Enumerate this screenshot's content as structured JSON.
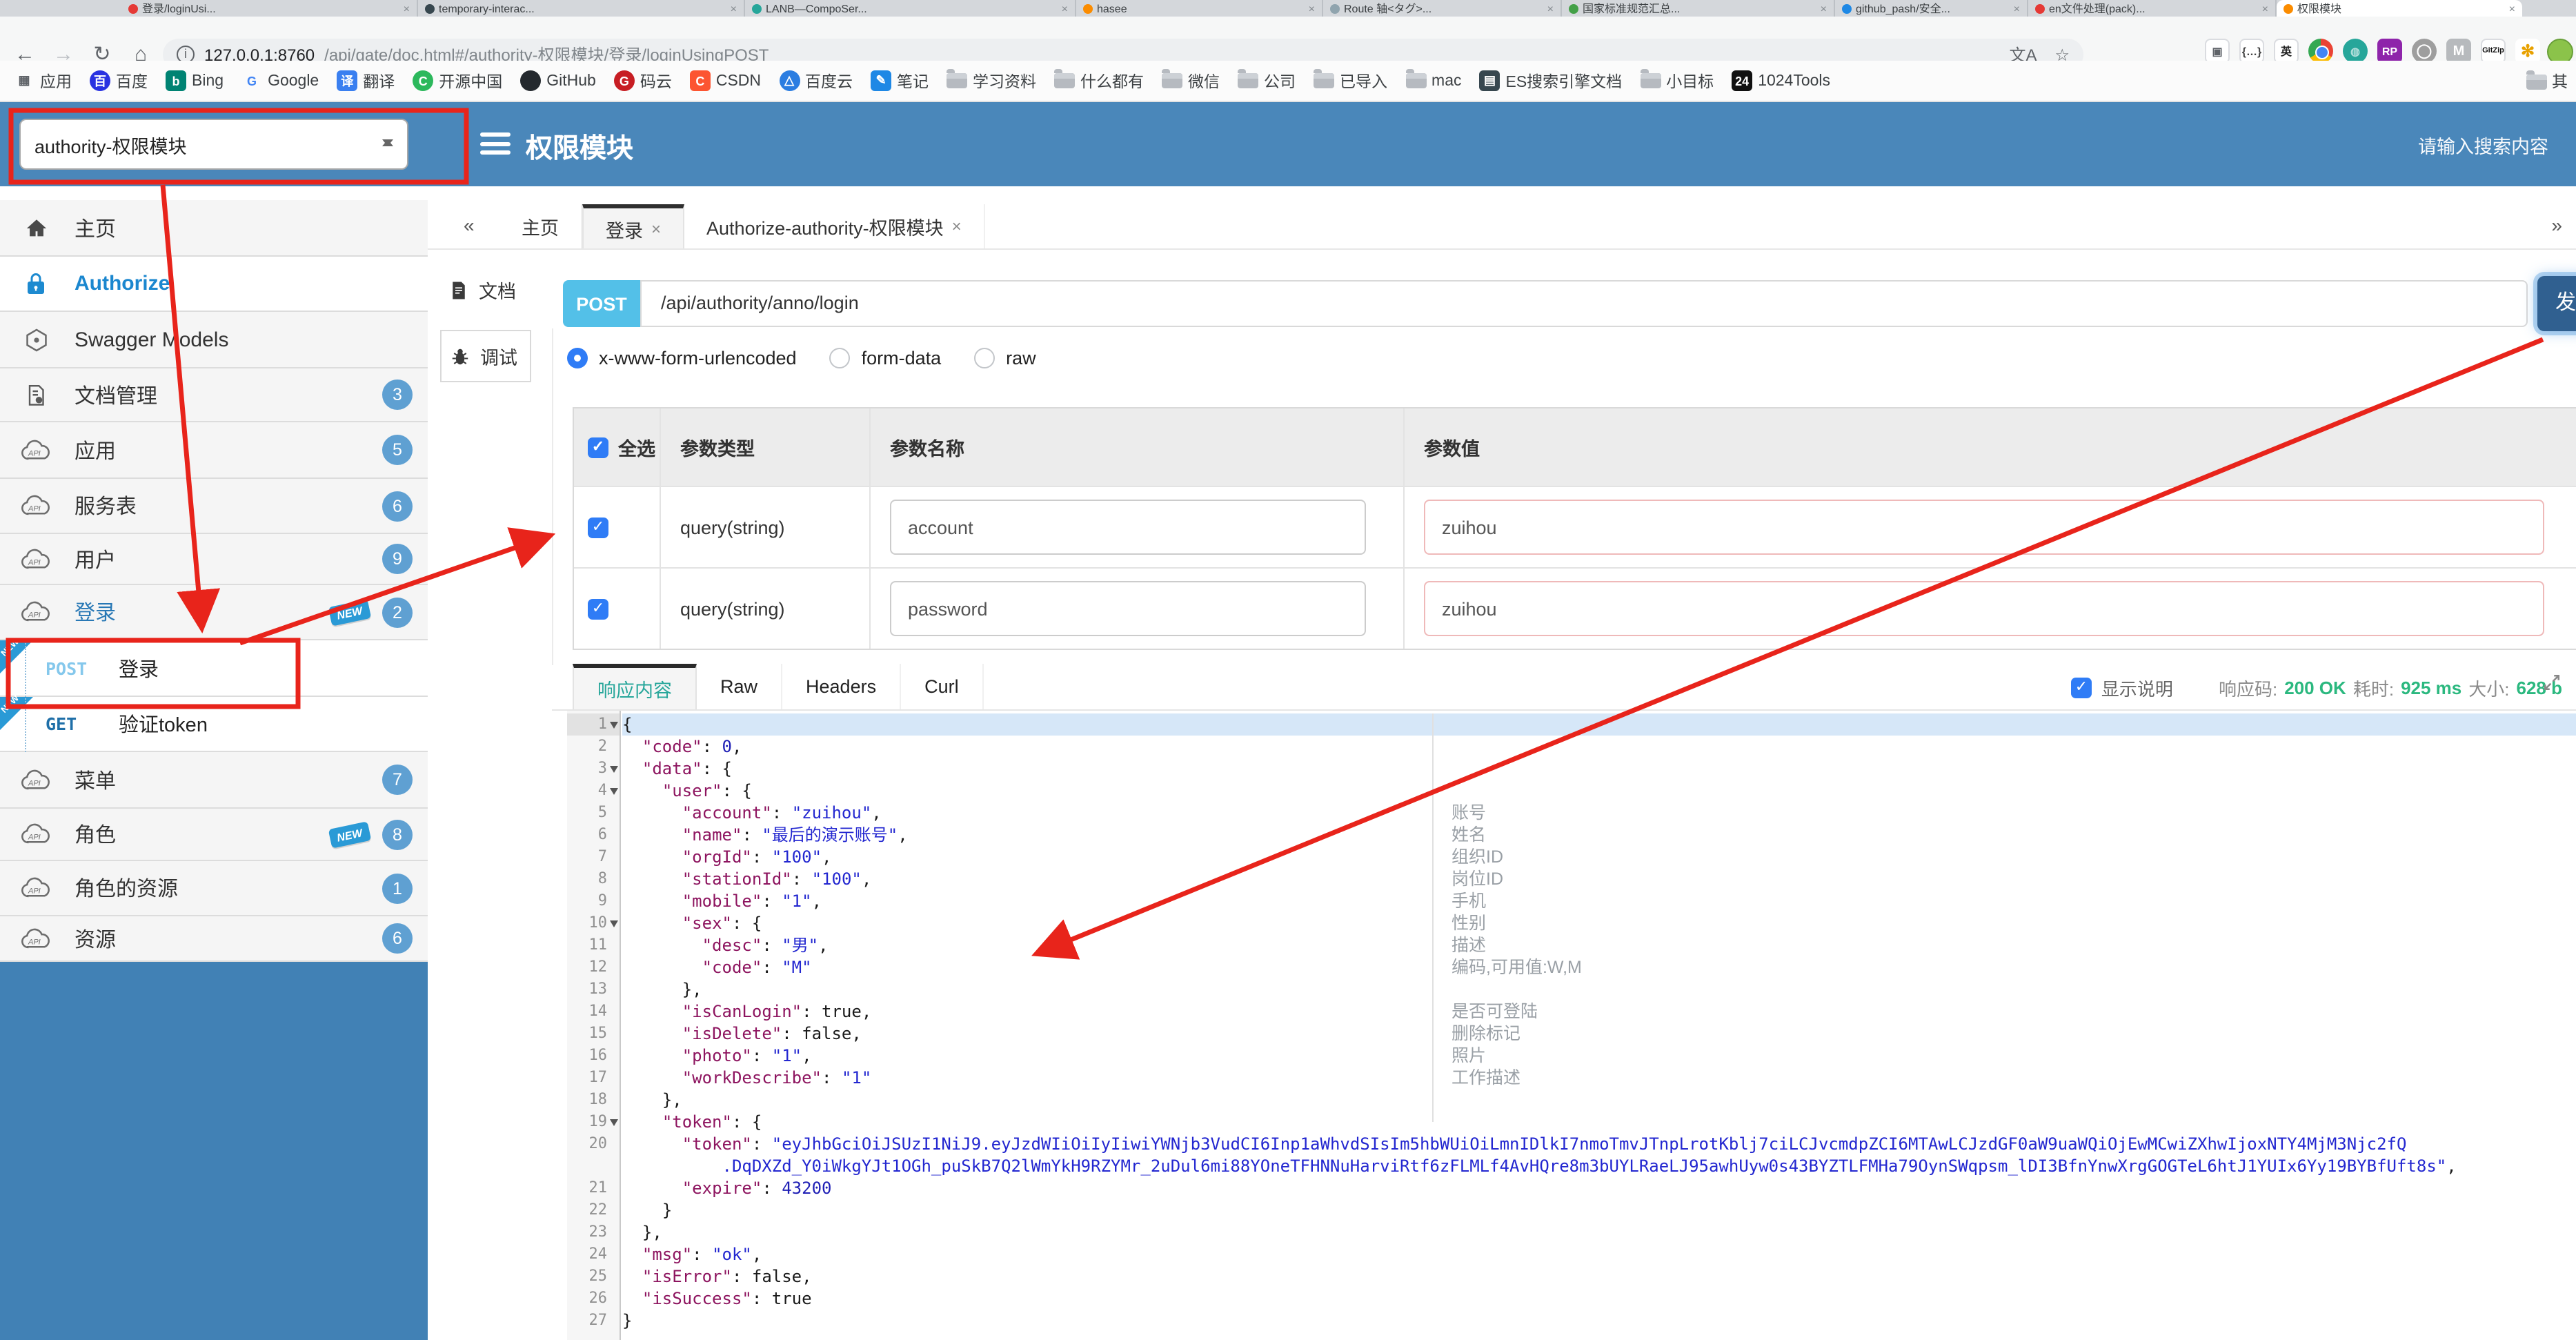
{
  "browser": {
    "tabs": [
      {
        "label": "登录/loginUsi...",
        "color": "#e53935"
      },
      {
        "label": "temporary-interac...",
        "color": "#37474f"
      },
      {
        "label": "LANB—CompoSer...",
        "color": "#26a69a"
      },
      {
        "label": "hasee",
        "color": "#fb8c00"
      },
      {
        "label": "Route 轴<タグ>...",
        "color": "#90a4ae"
      },
      {
        "label": "国家标准规范汇总...",
        "color": "#43a047"
      },
      {
        "label": "github_pash/安全...",
        "color": "#1e88e5"
      },
      {
        "label": "en文件处理(pack)...",
        "color": "#e53935"
      },
      {
        "label": "权限模块",
        "color": "#fb8c00",
        "active": true
      }
    ],
    "url_host": "127.0.0.1:8760",
    "url_path": "/api/gate/doc.html#/authority-权限模块/登录/loginUsingPOST",
    "bookmarks": [
      {
        "label": "应用",
        "icon": "apps"
      },
      {
        "label": "百度",
        "icon": "baidu"
      },
      {
        "label": "Bing",
        "icon": "bing"
      },
      {
        "label": "Google",
        "icon": "google"
      },
      {
        "label": "翻译",
        "icon": "translate"
      },
      {
        "label": "开源中国",
        "icon": "osc"
      },
      {
        "label": "GitHub",
        "icon": "github"
      },
      {
        "label": "码云",
        "icon": "gitee"
      },
      {
        "label": "CSDN",
        "icon": "csdn"
      },
      {
        "label": "百度云",
        "icon": "baiduyun"
      },
      {
        "label": "笔记",
        "icon": "note"
      },
      {
        "label": "学习资料",
        "icon": "folder"
      },
      {
        "label": "什么都有",
        "icon": "folder"
      },
      {
        "label": "微信",
        "icon": "folder"
      },
      {
        "label": "公司",
        "icon": "folder"
      },
      {
        "label": "已导入",
        "icon": "folder"
      },
      {
        "label": "mac",
        "icon": "folder"
      },
      {
        "label": "ES搜索引擎文档",
        "icon": "book"
      },
      {
        "label": "小目标",
        "icon": "folder"
      },
      {
        "label": "1024Tools",
        "icon": "tools1024"
      }
    ],
    "bookmark_overflow": {
      "label": "其",
      "icon": "folder"
    },
    "extensions": [
      "postman",
      "braces",
      "en-translate",
      "chrome",
      "globe",
      "rp",
      "ring",
      "m-chevron",
      "gitzip",
      "pinwheel"
    ]
  },
  "header": {
    "module_select": "authority-权限模块",
    "title": "权限模块",
    "search_placeholder": "请输入搜索内容"
  },
  "sidebar": {
    "items": [
      {
        "label": "主页",
        "icon": "home"
      },
      {
        "label": "Authorize",
        "icon": "lock",
        "active": true
      },
      {
        "label": "Swagger Models",
        "icon": "swagger"
      },
      {
        "label": "文档管理",
        "icon": "docs",
        "badge": "3"
      },
      {
        "label": "应用",
        "icon": "cloud",
        "badge": "5"
      },
      {
        "label": "服务表",
        "icon": "cloud",
        "badge": "6"
      },
      {
        "label": "用户",
        "icon": "cloud",
        "badge": "9"
      },
      {
        "label": "登录",
        "icon": "cloud",
        "badge": "2",
        "new": true,
        "open": true
      },
      {
        "child": true,
        "method": "POST",
        "label": "登录",
        "new": true,
        "boxed": true
      },
      {
        "child": true,
        "method": "GET",
        "label": "验证token",
        "new": true
      },
      {
        "label": "菜单",
        "icon": "cloud",
        "badge": "7"
      },
      {
        "label": "角色",
        "icon": "cloud",
        "badge": "8",
        "new": true
      },
      {
        "label": "角色的资源",
        "icon": "cloud",
        "badge": "1"
      },
      {
        "label": "资源",
        "icon": "cloud",
        "badge": "6"
      }
    ]
  },
  "tabbar": {
    "collapse": "«",
    "expand": "»",
    "tabs": [
      {
        "label": "主页",
        "closable": false
      },
      {
        "label": "登录",
        "closable": true,
        "active": true
      },
      {
        "label": "Authorize-authority-权限模块",
        "closable": true
      }
    ]
  },
  "doc_nav": {
    "doc": "文档",
    "debug": "调试"
  },
  "request": {
    "method": "POST",
    "url": "/api/authority/anno/login",
    "send_label": "发",
    "content_types": [
      "x-www-form-urlencoded",
      "form-data",
      "raw"
    ],
    "selected_type": 0
  },
  "params": {
    "headers": [
      "全选",
      "参数类型",
      "参数名称",
      "参数值"
    ],
    "rows": [
      {
        "checked": true,
        "type": "query(string)",
        "name": "account",
        "value": "zuihou"
      },
      {
        "checked": true,
        "type": "query(string)",
        "name": "password",
        "value": "zuihou"
      }
    ]
  },
  "response": {
    "tabs": [
      "响应内容",
      "Raw",
      "Headers",
      "Curl"
    ],
    "active_tab": 0,
    "show_desc_label": "显示说明",
    "code_label": "响应码:",
    "code_value": "200 OK",
    "time_label": "耗时:",
    "time_value": "925 ms",
    "size_label": "大小:",
    "size_value": "628 b"
  },
  "editor": {
    "rows": [
      {
        "n": "1",
        "f": true,
        "a": true,
        "t": [
          [
            "p",
            "{"
          ]
        ]
      },
      {
        "n": "2",
        "t": [
          [
            "w",
            "  "
          ],
          [
            "k",
            "\"code\""
          ],
          [
            "p",
            ": "
          ],
          [
            "n",
            "0"
          ],
          [
            "p",
            ","
          ]
        ]
      },
      {
        "n": "3",
        "f": true,
        "t": [
          [
            "w",
            "  "
          ],
          [
            "k",
            "\"data\""
          ],
          [
            "p",
            ": {"
          ]
        ]
      },
      {
        "n": "4",
        "f": true,
        "t": [
          [
            "w",
            "    "
          ],
          [
            "k",
            "\"user\""
          ],
          [
            "p",
            ": {"
          ]
        ]
      },
      {
        "n": "5",
        "t": [
          [
            "w",
            "      "
          ],
          [
            "k",
            "\"account\""
          ],
          [
            "p",
            ": "
          ],
          [
            "s",
            "\"zuihou\""
          ],
          [
            "p",
            ","
          ]
        ]
      },
      {
        "n": "6",
        "t": [
          [
            "w",
            "      "
          ],
          [
            "k",
            "\"name\""
          ],
          [
            "p",
            ": "
          ],
          [
            "s",
            "\"最后的演示账号\""
          ],
          [
            "p",
            ","
          ]
        ]
      },
      {
        "n": "7",
        "t": [
          [
            "w",
            "      "
          ],
          [
            "k",
            "\"orgId\""
          ],
          [
            "p",
            ": "
          ],
          [
            "s",
            "\"100\""
          ],
          [
            "p",
            ","
          ]
        ]
      },
      {
        "n": "8",
        "t": [
          [
            "w",
            "      "
          ],
          [
            "k",
            "\"stationId\""
          ],
          [
            "p",
            ": "
          ],
          [
            "s",
            "\"100\""
          ],
          [
            "p",
            ","
          ]
        ]
      },
      {
        "n": "9",
        "t": [
          [
            "w",
            "      "
          ],
          [
            "k",
            "\"mobile\""
          ],
          [
            "p",
            ": "
          ],
          [
            "s",
            "\"1\""
          ],
          [
            "p",
            ","
          ]
        ]
      },
      {
        "n": "10",
        "f": true,
        "t": [
          [
            "w",
            "      "
          ],
          [
            "k",
            "\"sex\""
          ],
          [
            "p",
            ": {"
          ]
        ]
      },
      {
        "n": "11",
        "t": [
          [
            "w",
            "        "
          ],
          [
            "k",
            "\"desc\""
          ],
          [
            "p",
            ": "
          ],
          [
            "s",
            "\"男\""
          ],
          [
            "p",
            ","
          ]
        ]
      },
      {
        "n": "12",
        "t": [
          [
            "w",
            "        "
          ],
          [
            "k",
            "\"code\""
          ],
          [
            "p",
            ": "
          ],
          [
            "s",
            "\"M\""
          ]
        ]
      },
      {
        "n": "13",
        "t": [
          [
            "w",
            "      "
          ],
          [
            "p",
            "},"
          ]
        ]
      },
      {
        "n": "14",
        "t": [
          [
            "w",
            "      "
          ],
          [
            "k",
            "\"isCanLogin\""
          ],
          [
            "p",
            ": "
          ],
          [
            "b",
            "true"
          ],
          [
            "p",
            ","
          ]
        ]
      },
      {
        "n": "15",
        "t": [
          [
            "w",
            "      "
          ],
          [
            "k",
            "\"isDelete\""
          ],
          [
            "p",
            ": "
          ],
          [
            "b",
            "false"
          ],
          [
            "p",
            ","
          ]
        ]
      },
      {
        "n": "16",
        "t": [
          [
            "w",
            "      "
          ],
          [
            "k",
            "\"photo\""
          ],
          [
            "p",
            ": "
          ],
          [
            "s",
            "\"1\""
          ],
          [
            "p",
            ","
          ]
        ]
      },
      {
        "n": "17",
        "t": [
          [
            "w",
            "      "
          ],
          [
            "k",
            "\"workDescribe\""
          ],
          [
            "p",
            ": "
          ],
          [
            "s",
            "\"1\""
          ]
        ]
      },
      {
        "n": "18",
        "t": [
          [
            "w",
            "    "
          ],
          [
            "p",
            "},"
          ]
        ]
      },
      {
        "n": "19",
        "f": true,
        "t": [
          [
            "w",
            "    "
          ],
          [
            "k",
            "\"token\""
          ],
          [
            "p",
            ": {"
          ]
        ]
      },
      {
        "n": "20",
        "t": [
          [
            "w",
            "      "
          ],
          [
            "k",
            "\"token\""
          ],
          [
            "p",
            ": "
          ],
          [
            "s",
            "\"eyJhbGciOiJSUzI1NiJ9.eyJzdWIiOiIyIiwiYWNjb3VudCI6Inp1aWhvdSIsIm5hbWUiOiLmnIDlkI7nmoTmvJTnpLrotKblj7ciLCJvcmdpZCI6MTAwLCJzdGF0aW9uaWQiOjEwMCwiZXhwIjoxNTY4MjM3Njc2fQ"
          ]
        ]
      },
      {
        "n": "",
        "t": [
          [
            "w",
            "          "
          ],
          [
            "s",
            ".DqDXZd_Y0iWkgYJt1OGh_puSkB7Q2lWmYkH9RZYMr_2uDul6mi88YOneTFHNNuHarviRtf6zFLMLf4AvHQre8m3bUYLRaeLJ95awhUyw0s43BYZTLFMHa79OynSWqpsm_lDI3BfnYnwXrgGOGTeL6htJ1YUIx6Yy19BYBfUft8s\""
          ],
          [
            "p",
            ","
          ]
        ]
      },
      {
        "n": "21",
        "t": [
          [
            "w",
            "      "
          ],
          [
            "k",
            "\"expire\""
          ],
          [
            "p",
            ": "
          ],
          [
            "n",
            "43200"
          ]
        ]
      },
      {
        "n": "22",
        "t": [
          [
            "w",
            "    "
          ],
          [
            "p",
            "}"
          ]
        ]
      },
      {
        "n": "23",
        "t": [
          [
            "w",
            "  "
          ],
          [
            "p",
            "},"
          ]
        ]
      },
      {
        "n": "24",
        "t": [
          [
            "w",
            "  "
          ],
          [
            "k",
            "\"msg\""
          ],
          [
            "p",
            ": "
          ],
          [
            "s",
            "\"ok\""
          ],
          [
            "p",
            ","
          ]
        ]
      },
      {
        "n": "25",
        "t": [
          [
            "w",
            "  "
          ],
          [
            "k",
            "\"isError\""
          ],
          [
            "p",
            ": "
          ],
          [
            "b",
            "false"
          ],
          [
            "p",
            ","
          ]
        ]
      },
      {
        "n": "26",
        "t": [
          [
            "w",
            "  "
          ],
          [
            "k",
            "\"isSuccess\""
          ],
          [
            "p",
            ": "
          ],
          [
            "b",
            "true"
          ]
        ]
      },
      {
        "n": "27",
        "t": [
          [
            "p",
            "}"
          ]
        ]
      }
    ],
    "annotations": [
      {
        "row": 5,
        "text": "账号"
      },
      {
        "row": 6,
        "text": "姓名"
      },
      {
        "row": 7,
        "text": "组织ID"
      },
      {
        "row": 8,
        "text": "岗位ID"
      },
      {
        "row": 9,
        "text": "手机"
      },
      {
        "row": 10,
        "text": "性别"
      },
      {
        "row": 11,
        "text": "描述"
      },
      {
        "row": 12,
        "text": "编码,可用值:W,M"
      },
      {
        "row": 14,
        "text": "是否可登陆"
      },
      {
        "row": 15,
        "text": "删除标记"
      },
      {
        "row": 16,
        "text": "照片"
      },
      {
        "row": 17,
        "text": "工作描述"
      }
    ]
  },
  "colors": {
    "header_blue": "#4a87ba",
    "annotation_red": "#e8241b",
    "success_green": "#2bb87f",
    "active_tab_teal": "#26a69a"
  }
}
